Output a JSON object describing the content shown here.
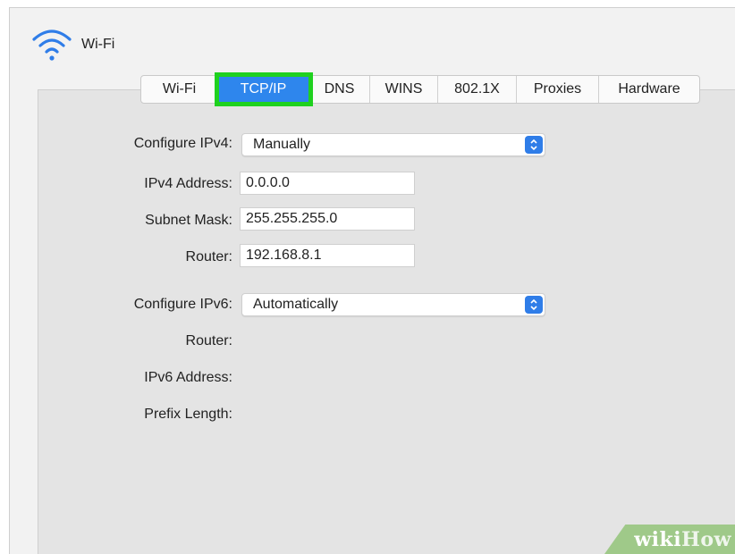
{
  "header": {
    "title": "Wi-Fi",
    "icon": "wifi-icon"
  },
  "tabs": [
    {
      "label": "Wi-Fi",
      "active": false
    },
    {
      "label": "TCP/IP",
      "active": true
    },
    {
      "label": "DNS",
      "active": false
    },
    {
      "label": "WINS",
      "active": false
    },
    {
      "label": "802.1X",
      "active": false
    },
    {
      "label": "Proxies",
      "active": false
    },
    {
      "label": "Hardware",
      "active": false
    }
  ],
  "ipv4": {
    "configure_label": "Configure IPv4:",
    "configure_value": "Manually",
    "address_label": "IPv4 Address:",
    "address_value": "0.0.0.0",
    "subnet_label": "Subnet Mask:",
    "subnet_value": "255.255.255.0",
    "router_label": "Router:",
    "router_value": "192.168.8.1"
  },
  "ipv6": {
    "configure_label": "Configure IPv6:",
    "configure_value": "Automatically",
    "router_label": "Router:",
    "address_label": "IPv6 Address:",
    "prefix_label": "Prefix Length:"
  },
  "watermark": {
    "part1": "wiki",
    "part2": "How"
  },
  "colors": {
    "accent": "#2e86ed",
    "highlight": "#1fd11f",
    "panel_bg": "#e4e4e4"
  }
}
